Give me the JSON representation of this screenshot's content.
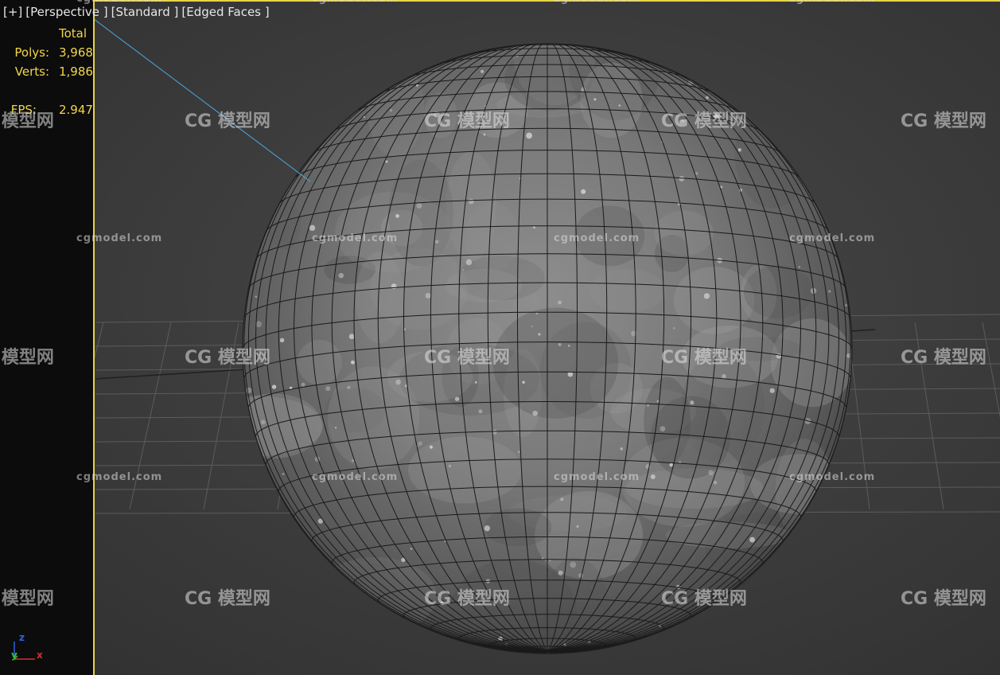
{
  "viewport": {
    "menu_plus": "[+]",
    "menu_view": "[Perspective ]",
    "menu_shading": "[Standard ]",
    "menu_style": "[Edged Faces ]"
  },
  "stats": {
    "total_label": "Total",
    "polys_label": "Polys:",
    "polys_value": "3,968",
    "verts_label": "Verts:",
    "verts_value": "1,986",
    "fps_label": "FPS:",
    "fps_value": "2.947"
  },
  "axis": {
    "z": "z",
    "y": "y",
    "x": "x"
  },
  "watermark": {
    "text": "cgmodel.com",
    "logo": "模型网"
  },
  "colors": {
    "viewport_bg": "#3d3d3d",
    "active_border": "#e7d44a",
    "stats_text": "#f2d64a",
    "menu_text": "#e6e6e6",
    "axis_x": "#d23030",
    "axis_y": "#30c030",
    "axis_z": "#3060e0"
  }
}
